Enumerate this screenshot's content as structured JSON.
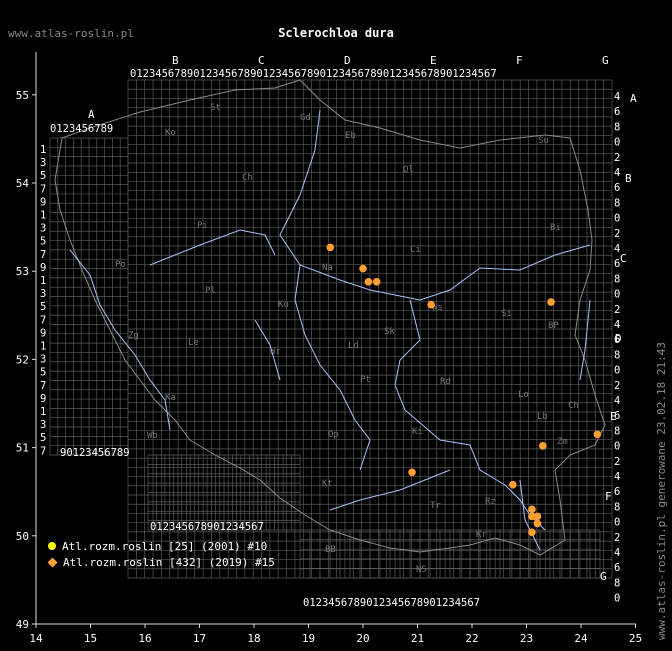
{
  "header": {
    "site": "www.atlas-roslin.pl",
    "title": "Sclerochloa dura",
    "generated": "www.atlas-roslin.pl generowane 23.02.18 21:43"
  },
  "axes": {
    "x_ticks": [
      "14",
      "15",
      "16",
      "17",
      "18",
      "19",
      "20",
      "21",
      "22",
      "23",
      "24",
      "25"
    ],
    "y_ticks": [
      "55",
      "54",
      "53",
      "52",
      "51",
      "50",
      "49"
    ]
  },
  "grid": {
    "top_letters": [
      "B",
      "C",
      "D",
      "E",
      "F",
      "G"
    ],
    "left_letter": "A",
    "right_letters": [
      "A",
      "B",
      "C",
      "D",
      "E",
      "F",
      "G"
    ],
    "digits": "0123456789",
    "left_col_digits": [
      "1",
      "3",
      "5",
      "7",
      "9",
      "1",
      "3",
      "5",
      "7",
      "9",
      "1",
      "3",
      "5",
      "7",
      "9",
      "1",
      "3",
      "5",
      "7",
      "9",
      "1",
      "3",
      "5",
      "7"
    ],
    "right_col_digits": [
      "4",
      "6",
      "8",
      "0",
      "2",
      "4",
      "6",
      "8",
      "0",
      "2",
      "4",
      "6",
      "8",
      "0",
      "2",
      "4",
      "6",
      "8",
      "0",
      "2",
      "4",
      "6",
      "8",
      "0",
      "2",
      "4",
      "6",
      "8",
      "0",
      "2",
      "4",
      "6",
      "8",
      "0"
    ]
  },
  "regions": [
    "St",
    "Ko",
    "Gd",
    "Eb",
    "Ch",
    "Ol",
    "Pi",
    "Su",
    "Bi",
    "Ci",
    "Na",
    "Po",
    "Pl",
    "Ws",
    "Ko",
    "Le",
    "Si",
    "BP",
    "Zg",
    "Lo",
    "Sk",
    "Wr",
    "Pt",
    "Rd",
    "Lb",
    "Ch",
    "Op",
    "Ki",
    "Zm",
    "Kt",
    "Tr",
    "Rz",
    "BB",
    "NS",
    "Kr",
    "Ka",
    "Wb",
    "Ld"
  ],
  "legend": [
    {
      "label": "Atl.rozm.roslin [25] (2001) #10",
      "color": "#ffff00",
      "marker": "circle"
    },
    {
      "label": "Atl.rozm.roslin [432] (2019) #15",
      "color": "#ffa030",
      "marker": "diamond"
    }
  ],
  "chart_data": {
    "type": "scatter",
    "title": "Sclerochloa dura",
    "xlim": [
      14,
      25
    ],
    "ylim": [
      49,
      55.3
    ],
    "series": [
      {
        "name": "Atl.rozm.roslin [432] (2019) #15",
        "color": "#ffa030",
        "points": [
          [
            19.4,
            53.27
          ],
          [
            20.0,
            53.03
          ],
          [
            20.1,
            52.88
          ],
          [
            20.25,
            52.88
          ],
          [
            21.25,
            52.62
          ],
          [
            23.45,
            52.65
          ],
          [
            24.3,
            51.15
          ],
          [
            23.3,
            51.02
          ],
          [
            20.9,
            50.72
          ],
          [
            22.75,
            50.58
          ],
          [
            23.1,
            50.3
          ],
          [
            23.2,
            50.22
          ],
          [
            23.1,
            50.22
          ],
          [
            23.2,
            50.14
          ],
          [
            23.1,
            50.04
          ]
        ]
      }
    ],
    "grid": true
  }
}
